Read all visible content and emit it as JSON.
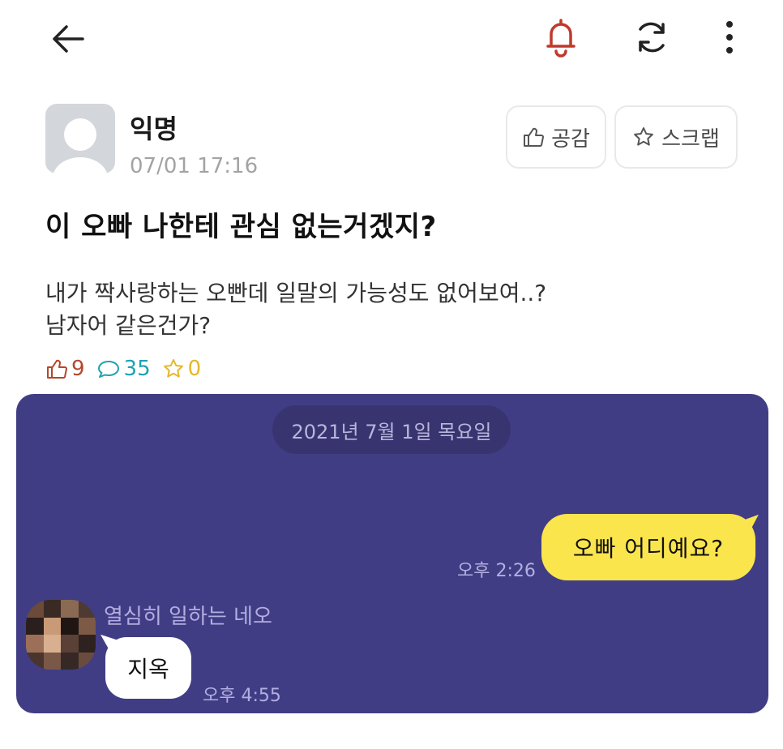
{
  "topbar": {
    "back_icon": "arrow-left-icon",
    "notify_icon": "bell-icon",
    "refresh_icon": "refresh-icon",
    "more_icon": "more-vertical-icon",
    "notify_color": "#c0392b"
  },
  "post": {
    "author": "익명",
    "time": "07/01 17:16",
    "like_button": "공감",
    "scrap_button": "스크랩",
    "title": "이 오빠 나한테 관심 없는거겠지?",
    "body": [
      "내가 짝사랑하는 오빤데 일말의 가능성도 없어보여..?",
      "남자어 같은건가?"
    ],
    "stats": {
      "likes": "9",
      "comments": "35",
      "scraps": "0"
    }
  },
  "chat": {
    "background": "#413d85",
    "date": "2021년 7월 1일 목요일",
    "sent_message": "오빠 어디예요?",
    "sent_time": "오후 2:26",
    "friend_name": "열심히 일하는 네오",
    "received_message": "지옥",
    "received_time": "오후 4:55"
  }
}
